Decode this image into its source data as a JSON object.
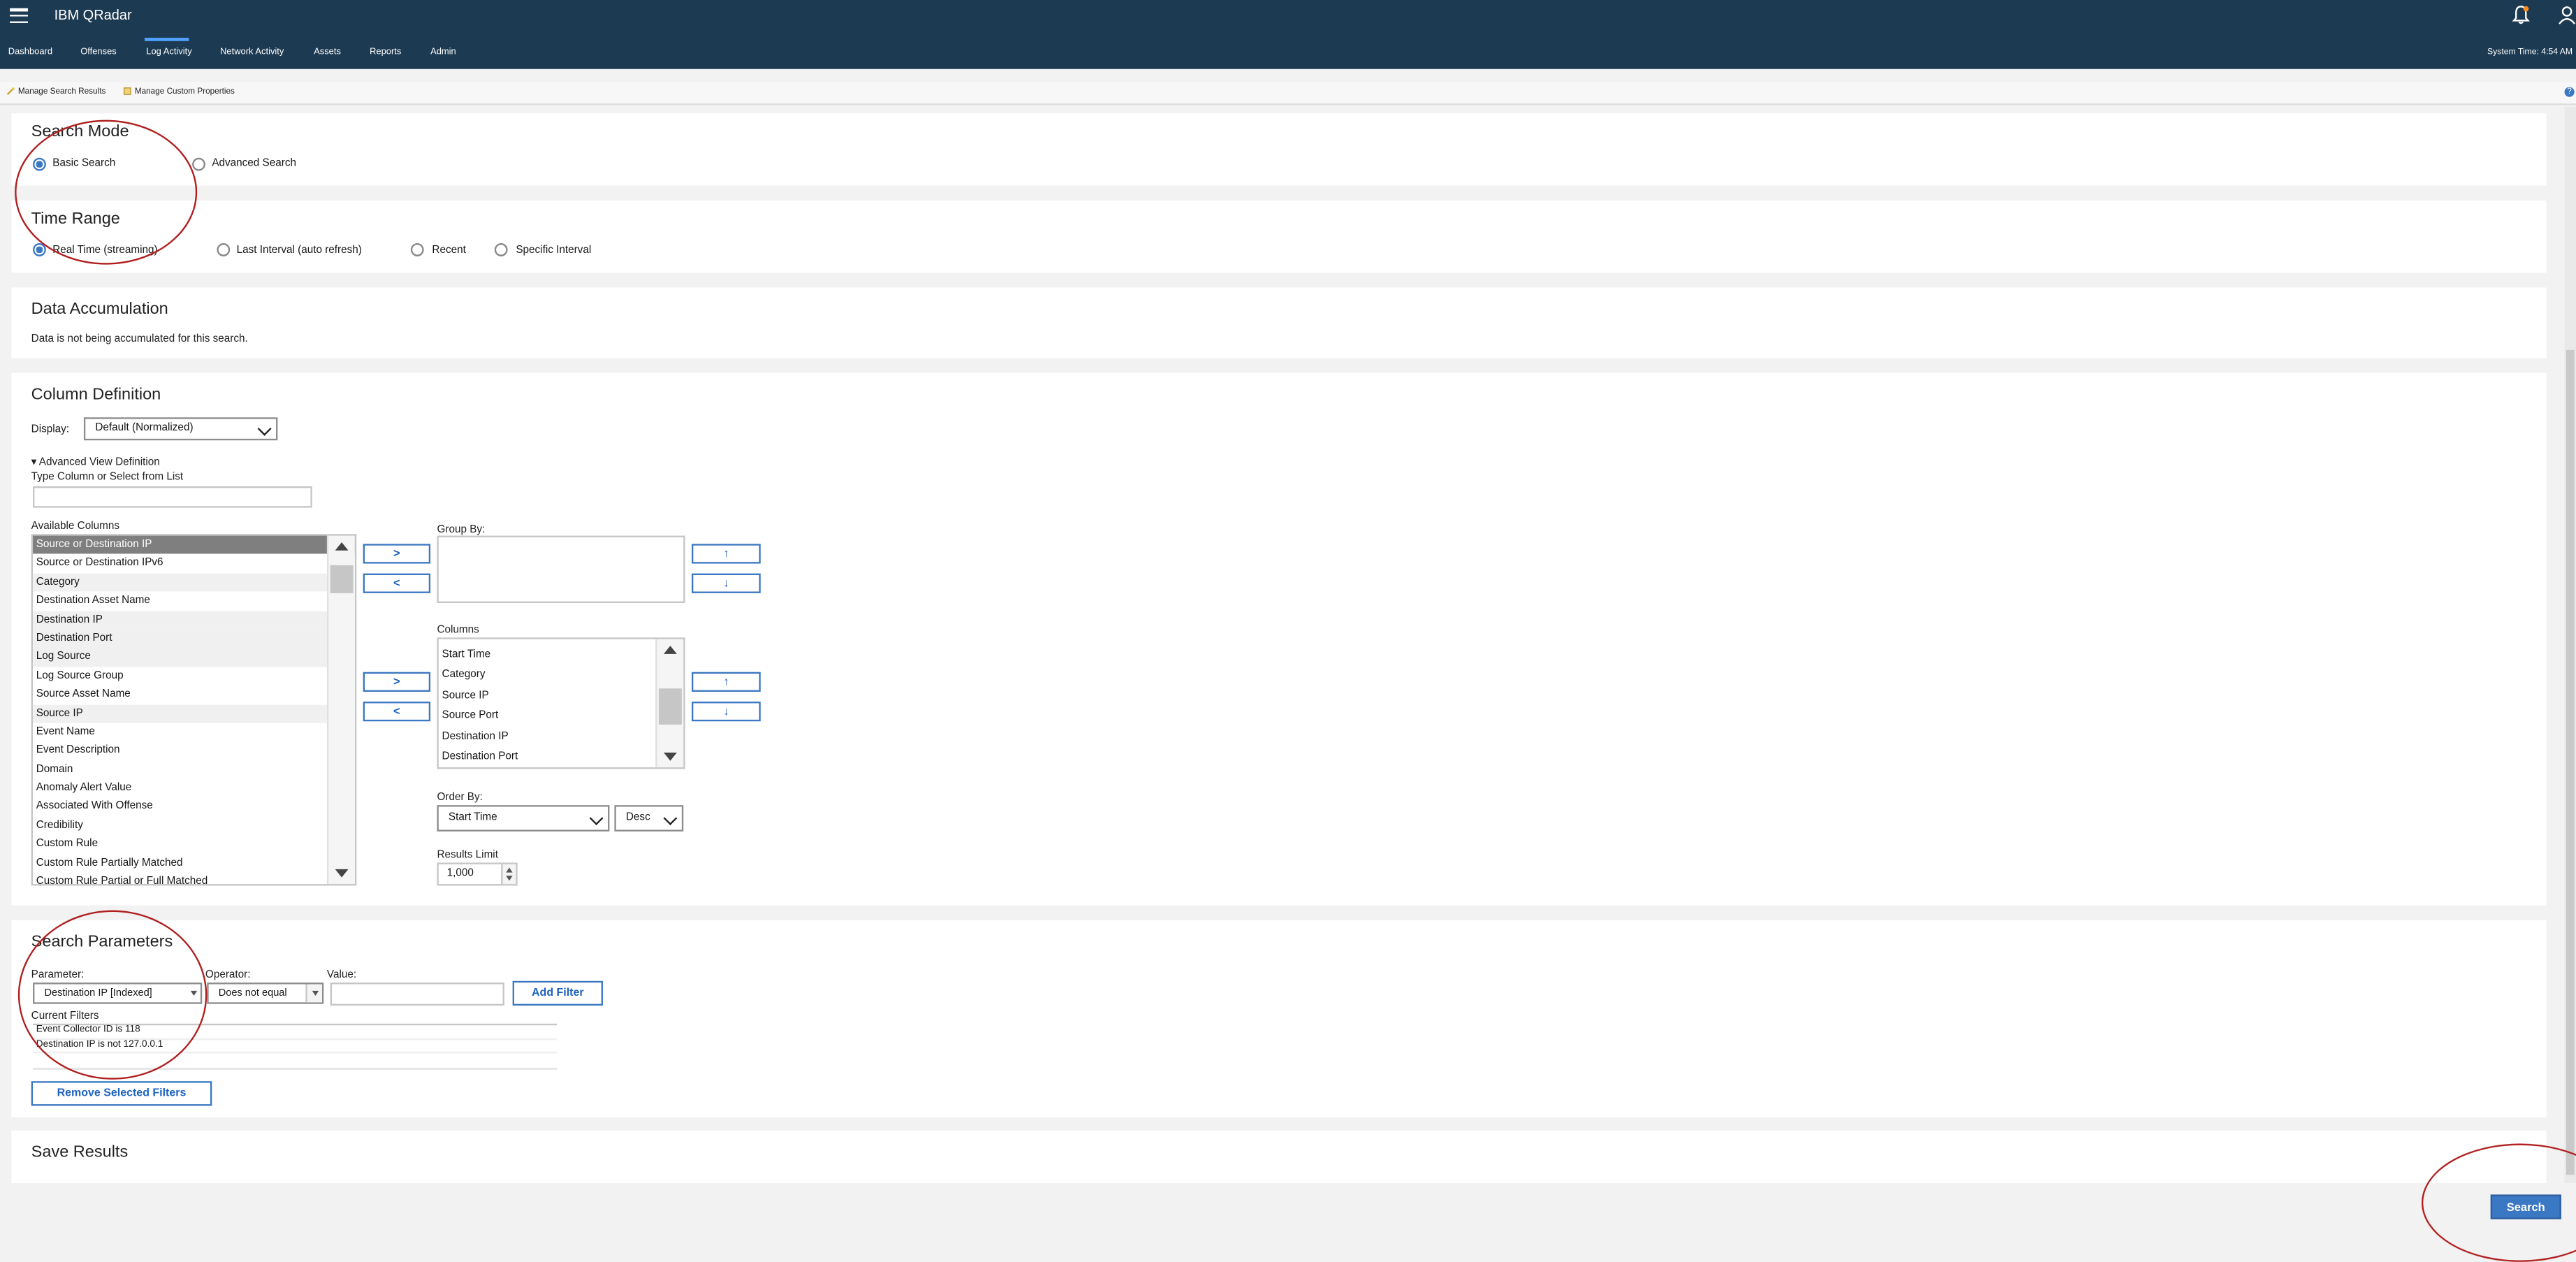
{
  "header": {
    "brand": "IBM QRadar",
    "nav": [
      "Dashboard",
      "Offenses",
      "Log Activity",
      "Network Activity",
      "Assets",
      "Reports",
      "Admin"
    ],
    "active_nav": "Log Activity",
    "system_time": "System Time: 4:54 AM"
  },
  "toolbar": {
    "manage_search_results": "Manage Search Results",
    "manage_custom_properties": "Manage Custom Properties",
    "help": "?"
  },
  "search_mode": {
    "title": "Search Mode",
    "basic": "Basic Search",
    "advanced": "Advanced Search",
    "selected": "Basic Search"
  },
  "time_range": {
    "title": "Time Range",
    "options": [
      "Real Time (streaming)",
      "Last Interval (auto refresh)",
      "Recent",
      "Specific Interval"
    ],
    "selected": "Real Time (streaming)"
  },
  "data_accumulation": {
    "title": "Data Accumulation",
    "message": "Data is not being accumulated for this search."
  },
  "column_definition": {
    "title": "Column Definition",
    "display_label": "Display:",
    "display_value": "Default (Normalized)",
    "advanced_toggle": "▾ Advanced View Definition",
    "type_column_label": "Type Column or Select from List",
    "available_label": "Available Columns",
    "available_columns": [
      "Source or Destination IP",
      "Source or Destination IPv6",
      "Category",
      "Destination Asset Name",
      "Destination IP",
      "Destination Port",
      "Log Source",
      "Log Source Group",
      "Source Asset Name",
      "Source IP",
      "Event Name",
      "Event Description",
      "Domain",
      "Anomaly Alert Value",
      "Associated With Offense",
      "Credibility",
      "Custom Rule",
      "Custom Rule Partially Matched",
      "Custom Rule Partial or Full Matched"
    ],
    "add_label": ">",
    "remove_label": "<",
    "up_label": "↑",
    "down_label": "↓",
    "group_by_label": "Group By:",
    "columns_label": "Columns",
    "columns": [
      "Start Time",
      "Category",
      "Source IP",
      "Source Port",
      "Destination IP",
      "Destination Port"
    ],
    "order_by_label": "Order By:",
    "order_by_value": "Start Time",
    "order_dir": "Desc",
    "results_limit_label": "Results Limit",
    "results_limit": "1,000"
  },
  "search_parameters": {
    "title": "Search Parameters",
    "parameter_label": "Parameter:",
    "parameter_value": "Destination IP [Indexed]",
    "operator_label": "Operator:",
    "operator_value": "Does not equal",
    "value_label": "Value:",
    "value": "",
    "add_filter": "Add Filter",
    "current_filters_label": "Current Filters",
    "filters": [
      "Event Collector ID is 118",
      "Destination IP is not 127.0.0.1"
    ],
    "remove_filters": "Remove Selected Filters"
  },
  "save_results": {
    "title": "Save Results"
  },
  "search_button": "Search",
  "colors": {
    "header_bg": "#1c3a52",
    "accent": "#3b78c3",
    "annotation": "#b01e1e"
  }
}
